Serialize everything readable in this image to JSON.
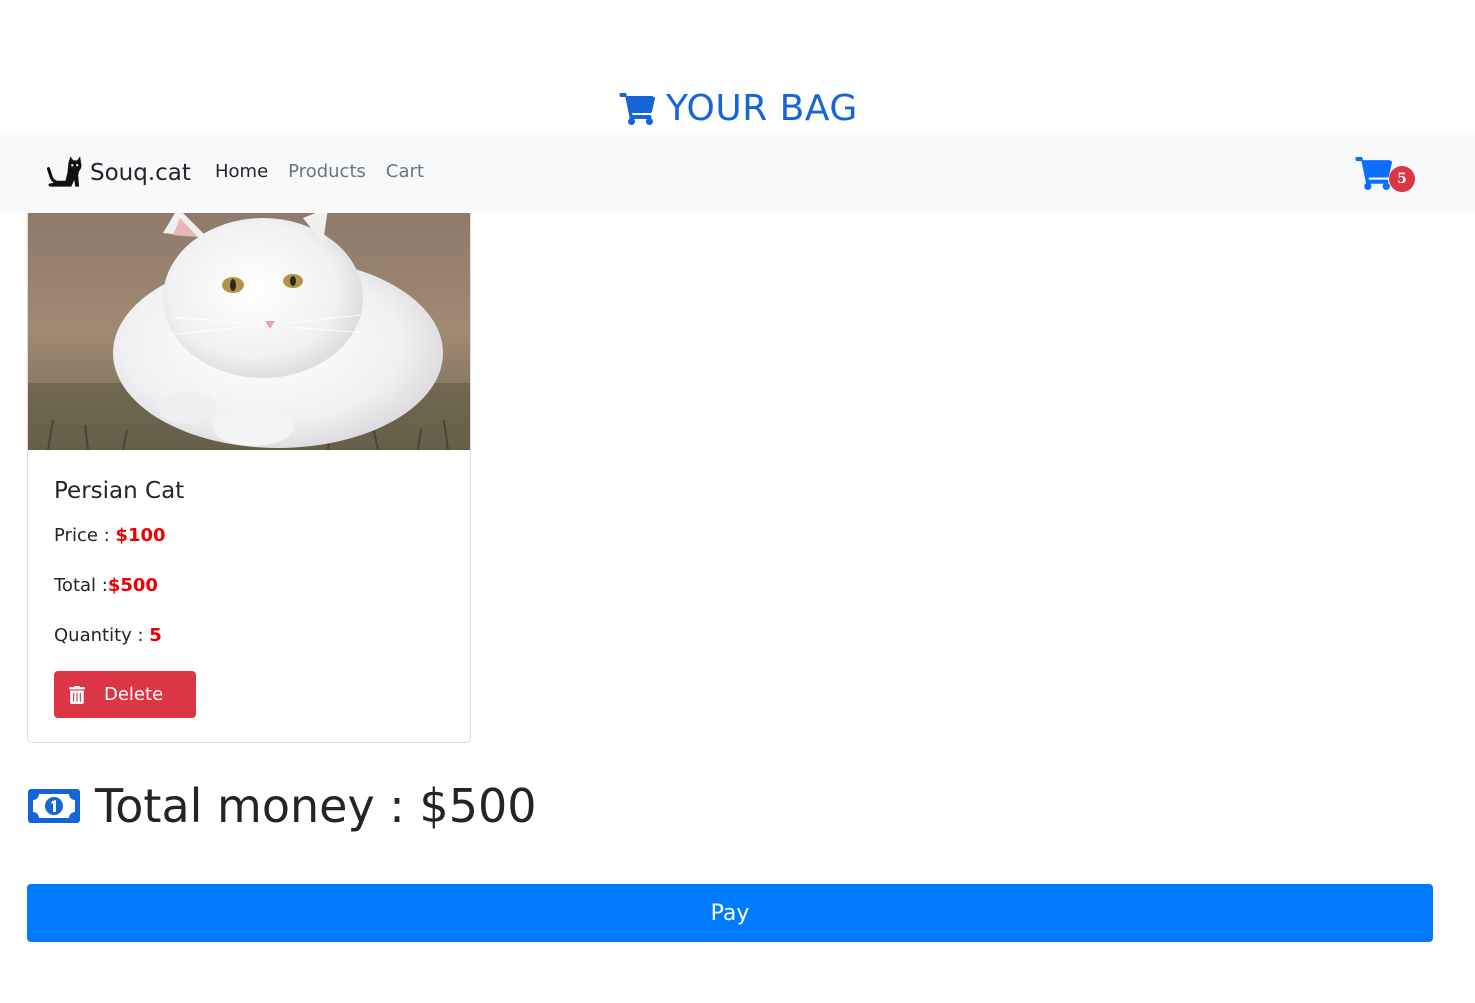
{
  "header": {
    "title": "YOUR BAG",
    "icon": "shopping-cart-icon"
  },
  "navbar": {
    "brand": "Souq.cat",
    "brand_icon": "cat-icon",
    "links": [
      {
        "label": "Home",
        "active": true
      },
      {
        "label": "Products",
        "active": false
      },
      {
        "label": "Cart",
        "active": false
      }
    ],
    "cart_icon": "shopping-cart-icon",
    "cart_count": "5"
  },
  "cart_items": [
    {
      "name": "Persian Cat",
      "image": "white-persian-cat-photo",
      "price_label": "Price : ",
      "price": "$100",
      "total_label": "Total :",
      "total": "$500",
      "quantity_label": "Quantity : ",
      "quantity": "5",
      "delete_label": "Delete"
    }
  ],
  "summary": {
    "icon": "money-bill-icon",
    "total_money": "Total money : $500"
  },
  "pay_label": "Pay",
  "colors": {
    "primary": "#007bff",
    "title_blue": "#1565d8",
    "danger": "#dc3545",
    "price_red": "#ee0000",
    "navbar_bg": "#f8f9fa"
  }
}
